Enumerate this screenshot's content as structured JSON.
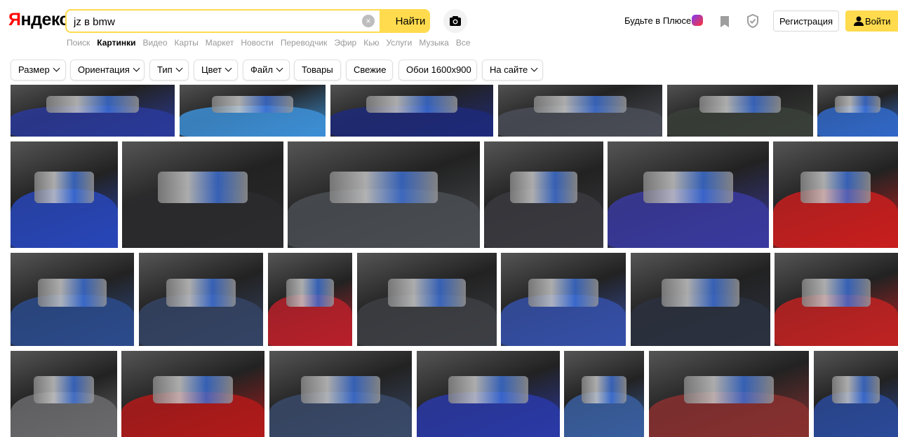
{
  "header": {
    "logo_first": "Я",
    "logo_rest": "ндекс",
    "search_value": "jz в bmw",
    "find_label": "Найти",
    "clear_label": "×",
    "plus_label": "Будьте в Плюсе",
    "register_label": "Регистрация",
    "login_label": "Войти"
  },
  "tabs": [
    "Поиск",
    "Картинки",
    "Видео",
    "Карты",
    "Маркет",
    "Новости",
    "Переводчик",
    "Эфир",
    "Кью",
    "Услуги",
    "Музыка",
    "Все"
  ],
  "active_tab": "Картинки",
  "filters": [
    {
      "label": "Размер",
      "dropdown": true
    },
    {
      "label": "Ориентация",
      "dropdown": true
    },
    {
      "label": "Тип",
      "dropdown": true
    },
    {
      "label": "Цвет",
      "dropdown": true
    },
    {
      "label": "Файл",
      "dropdown": true
    },
    {
      "label": "Товары",
      "dropdown": false
    },
    {
      "label": "Свежие",
      "dropdown": false
    },
    {
      "label": "Обои 1600x900",
      "dropdown": false
    },
    {
      "label": "На сайте",
      "dropdown": true
    }
  ],
  "colors": {
    "accent": "#ffdb4d",
    "logo_red": "#ff0000"
  },
  "image_rows": [
    [
      "#2a3a9a",
      "#3d8fd6",
      "#1f2a7a",
      "#4a4e57",
      "#3a3f3a",
      "#3168c8"
    ],
    [
      "#2846b8",
      "#2b2b2e",
      "#4a4d52",
      "#3a3a40",
      "#3a3aa0",
      "#c91f1f"
    ],
    [
      "#2c4b8c",
      "#354465",
      "#b8202a",
      "#3d3f44",
      "#3550a8",
      "#2b3140",
      "#c02222"
    ],
    [
      "#6b6b6e",
      "#b31a1a",
      "#3a4a6a",
      "#2a3aa8",
      "#3a5fa0",
      "#8a3030",
      "#2a4a9a"
    ]
  ]
}
